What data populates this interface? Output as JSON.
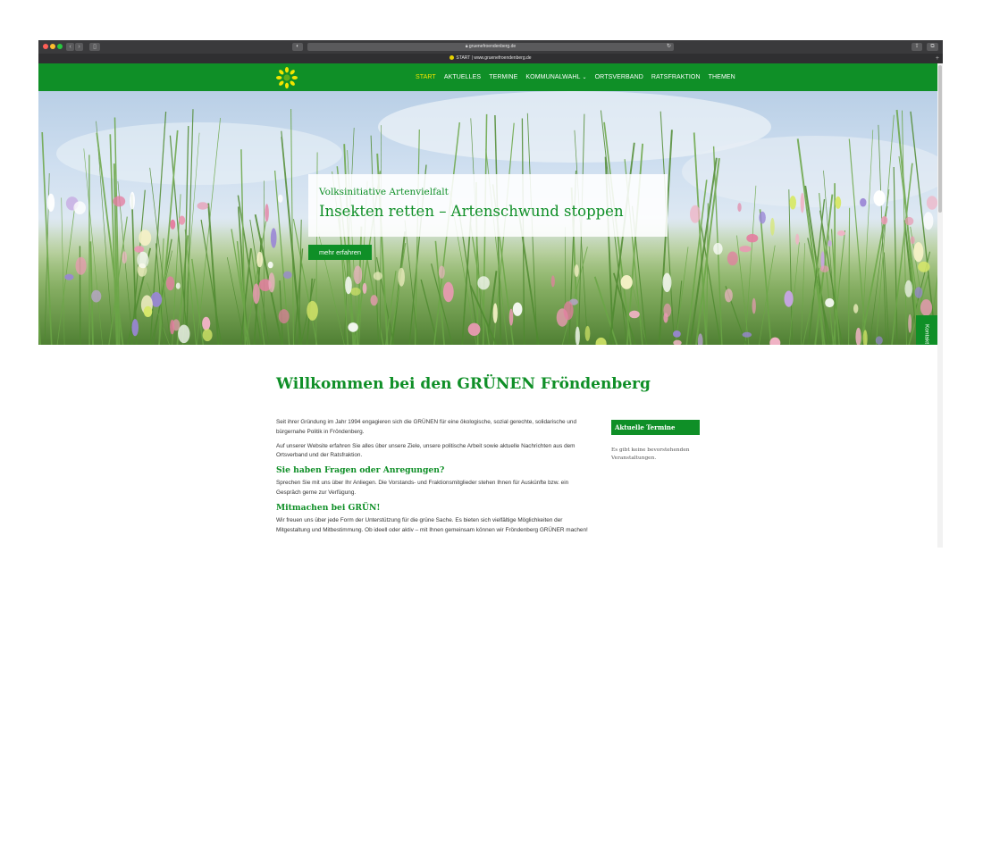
{
  "browser": {
    "url": "gruenefroendenberg.de",
    "tab_title": "START | www.gruenefroendenberg.de",
    "icons": {
      "back": "chevron-left-icon",
      "forward": "chevron-right-icon",
      "sidebar": "sidebar-icon",
      "shield": "shield-icon",
      "lock": "lock-icon",
      "reload": "reload-icon",
      "share": "share-icon",
      "tabs": "tabs-icon",
      "new_tab": "plus-icon"
    }
  },
  "site": {
    "brand_color": "#0f8f27",
    "active_nav_color": "#f2e500",
    "logo": "sunflower-logo-icon",
    "nav": [
      {
        "label": "START",
        "active": true
      },
      {
        "label": "AKTUELLES"
      },
      {
        "label": "TERMINE"
      },
      {
        "label": "KOMMUNALWAHL",
        "has_dropdown": true
      },
      {
        "label": "ORTSVERBAND"
      },
      {
        "label": "RATSFRAKTION"
      },
      {
        "label": "THEMEN"
      }
    ]
  },
  "hero": {
    "kicker": "Volksinitiative Artenvielfalt",
    "title": "Insekten retten – Artenschwund stoppen",
    "button": "mehr erfahren",
    "kontakt": "Kontakt"
  },
  "main": {
    "heading": "Willkommen bei den GRÜNEN Fröndenberg",
    "intro_1": "Seit ihrer Gründung im Jahr 1994 engagieren sich die GRÜNEN für eine ökologische, sozial gerechte, solidarische und bürgernahe Politik in Fröndenberg.",
    "intro_2": "Auf unserer Website erfahren Sie alles über unsere Ziele, unsere politische Arbeit sowie aktuelle Nachrichten aus dem Ortsverband und der Ratsfraktion.",
    "q_heading": "Sie haben Fragen oder Anregungen?",
    "q_text": "Sprechen Sie mit uns über Ihr Anliegen. Die Vorstands- und Fraktionsmitglieder stehen Ihnen für Auskünfte bzw. ein Gespräch gerne zur Verfügung.",
    "m_heading": "Mitmachen bei GRÜN!",
    "m_text": "Wir freuen uns über jede Form der Unterstützung für die grüne Sache. Es bieten sich vielfältige Möglichkeiten der Mitgestaltung und Mitbestimmung. Ob ideell oder aktiv – mit Ihnen gemeinsam können wir Fröndenberg GRÜNER machen!"
  },
  "sidebar": {
    "heading": "Aktuelle Termine",
    "text": "Es gibt keine bevorstehenden Veranstaltungen."
  }
}
